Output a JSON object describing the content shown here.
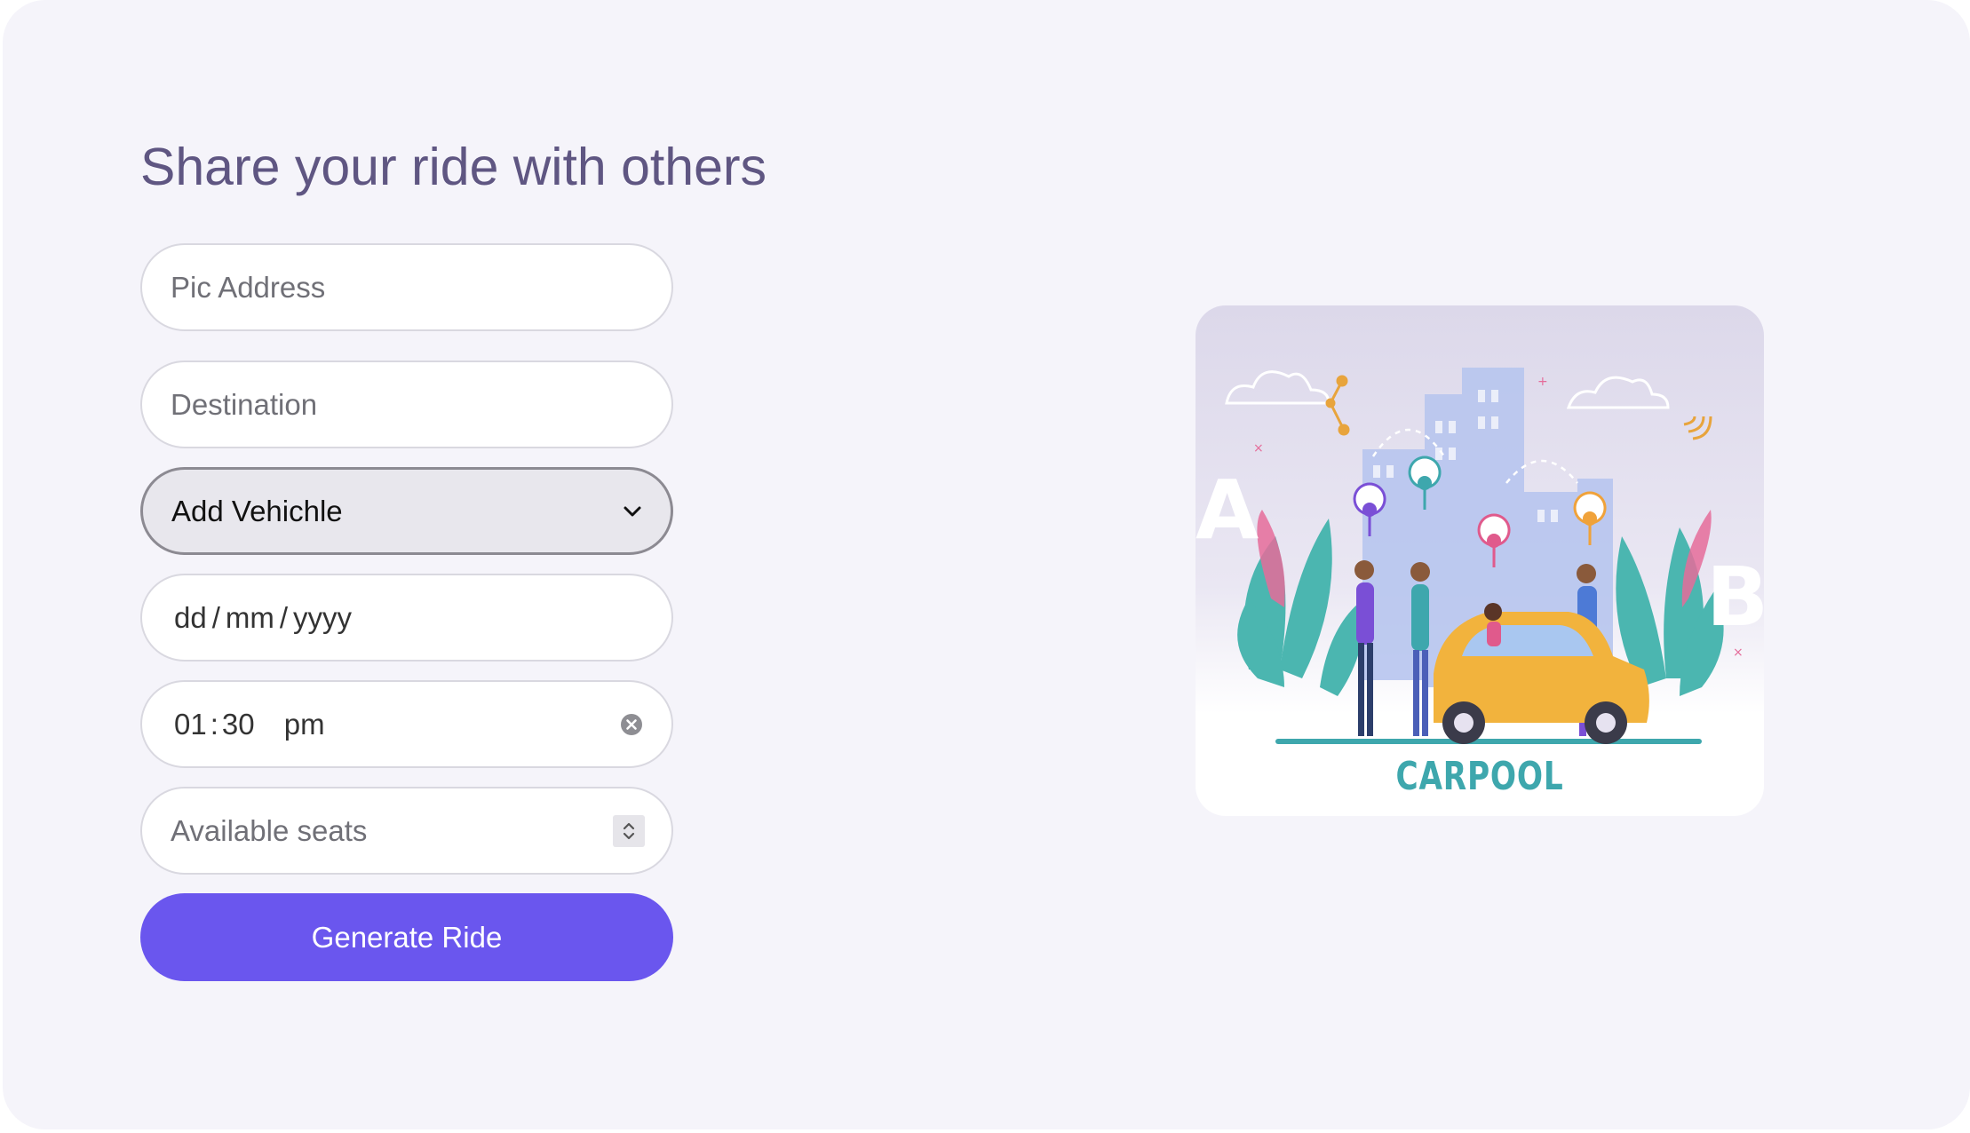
{
  "form": {
    "title": "Share your ride with others",
    "pickup_placeholder": "Pic Address",
    "destination_placeholder": "Destination",
    "vehicle_select": "Add Vehichle",
    "date": {
      "day": "dd",
      "month": "mm",
      "year": "yyyy"
    },
    "time": {
      "hour": "01",
      "minute": "30",
      "ampm": "pm"
    },
    "seats_placeholder": "Available seats",
    "submit_label": "Generate Ride"
  },
  "illustration": {
    "caption": "CARPOOL",
    "marker_a": "A",
    "marker_b": "B"
  },
  "colors": {
    "background": "#f5f4fa",
    "title": "#5f5682",
    "accent": "#6a56ee",
    "illustration_caption": "#3ea7ad",
    "car": "#f2b33d"
  },
  "icons": [
    "chevron-down-icon",
    "clear-icon",
    "spinner-arrows-icon"
  ]
}
